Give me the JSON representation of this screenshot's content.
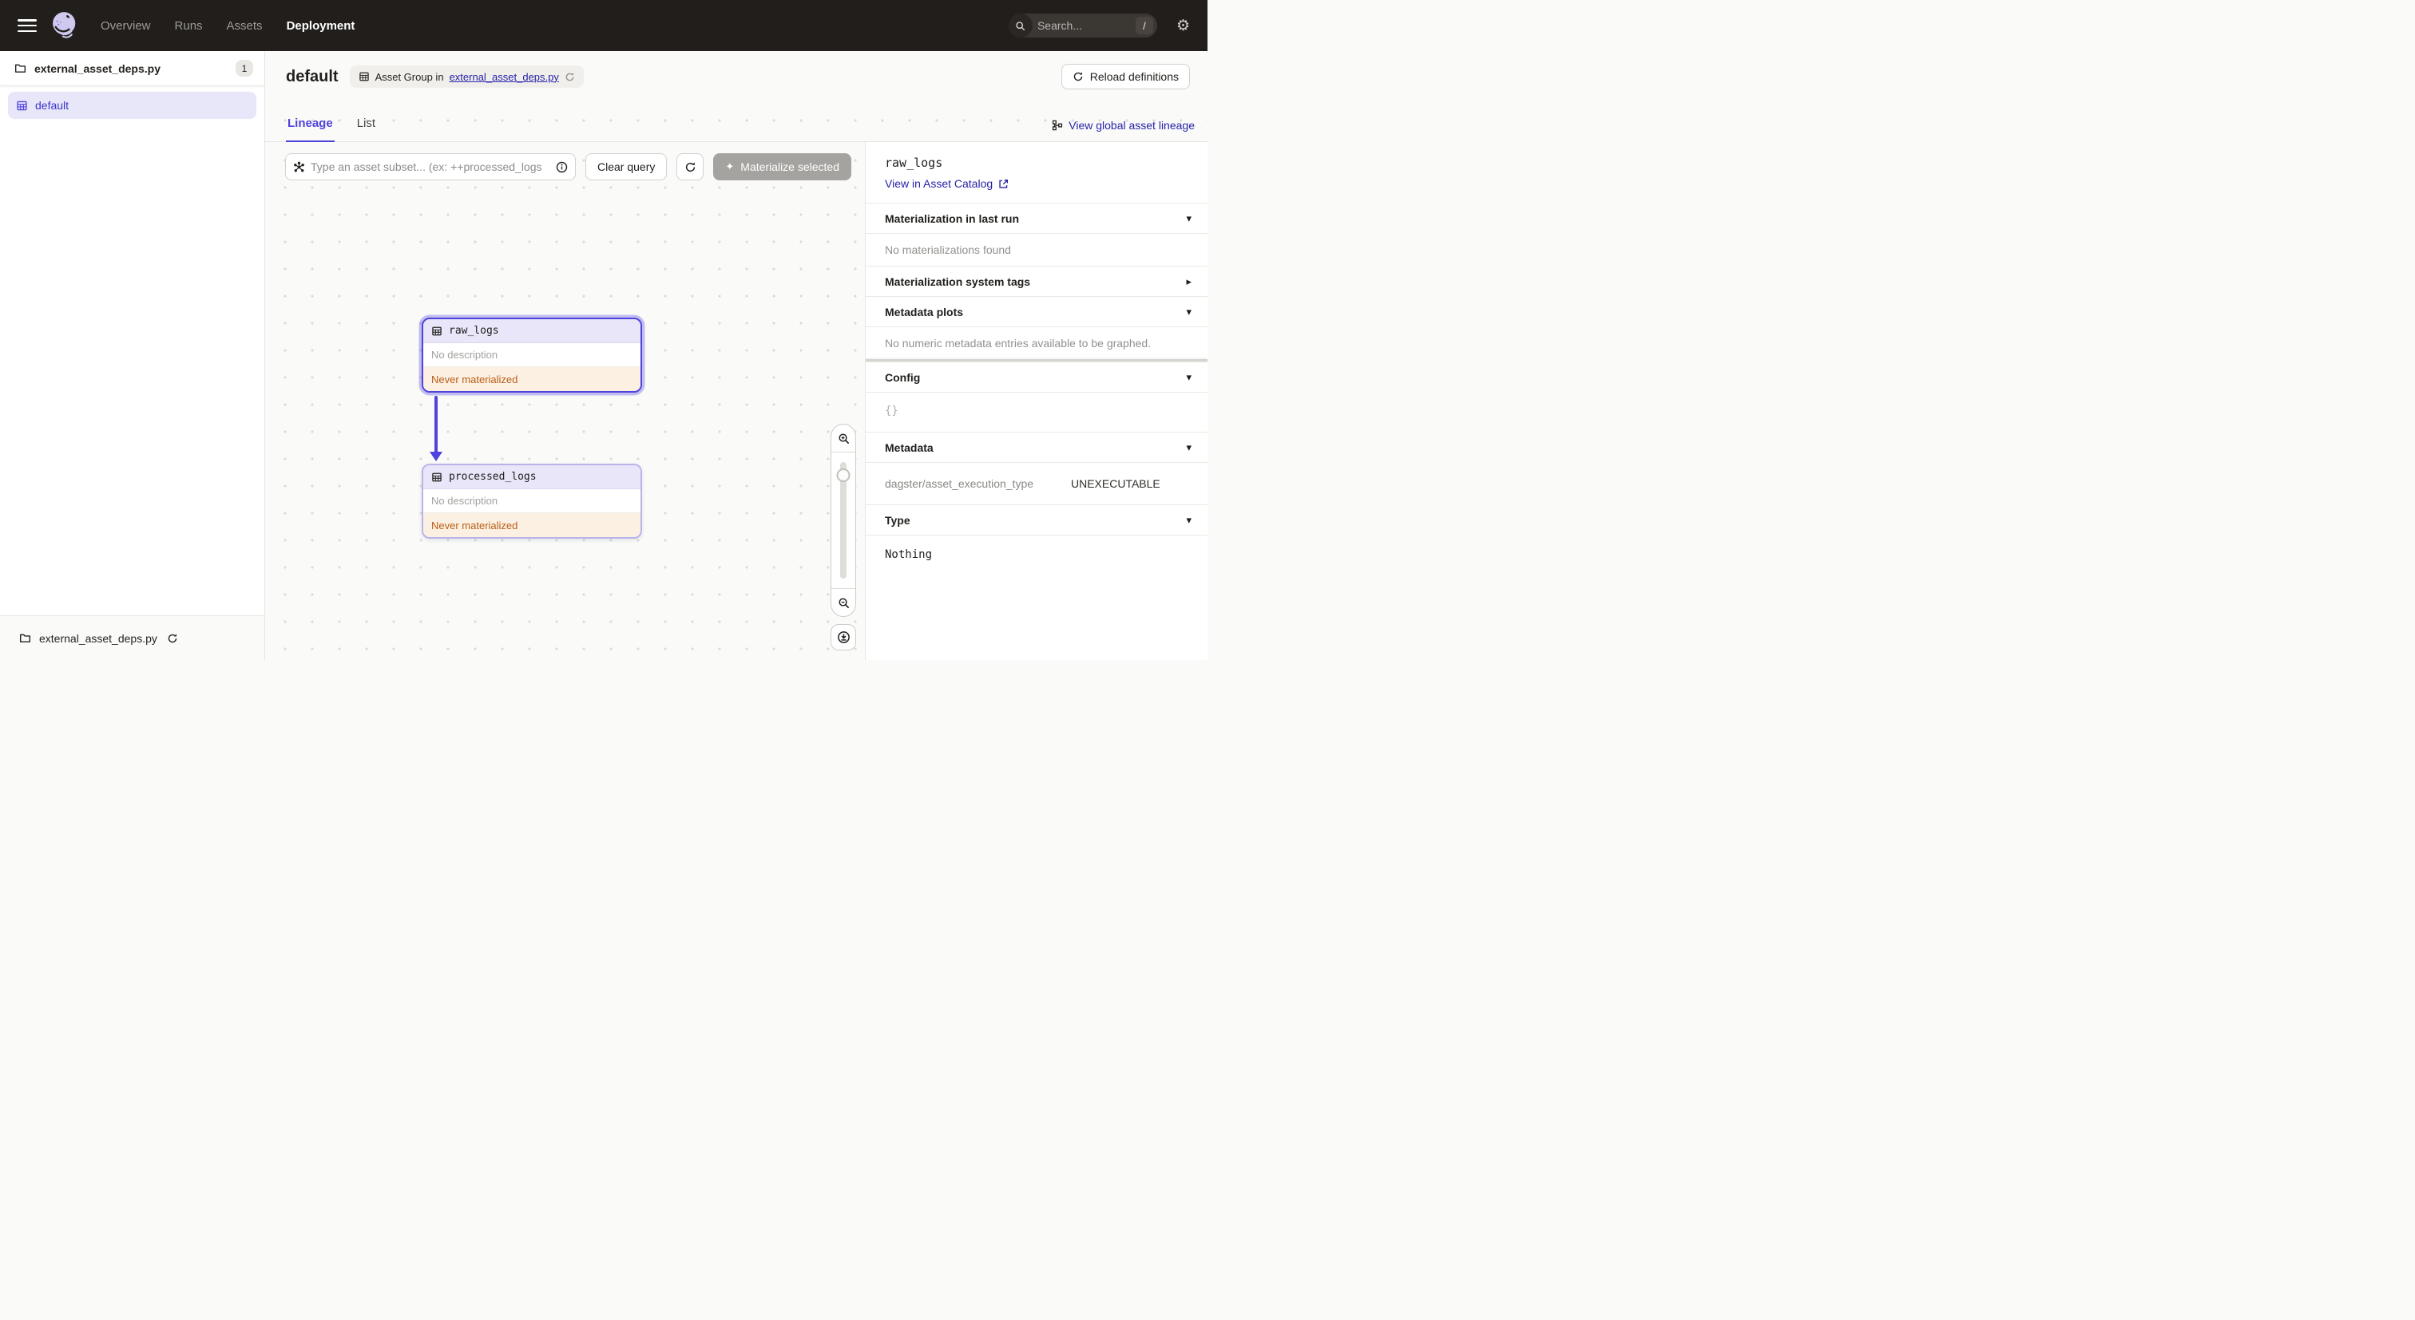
{
  "colors": {
    "accent": "#4F43DD",
    "link": "#2823A8",
    "warn_text": "#BA5D17",
    "warn_bg": "#FBF0E2",
    "nav_bg": "#211E1C",
    "selected_group_bg": "#E8E7FA"
  },
  "topnav": {
    "menu_items": [
      {
        "label": "Overview"
      },
      {
        "label": "Runs"
      },
      {
        "label": "Assets"
      },
      {
        "label": "Deployment"
      }
    ],
    "search_placeholder": "Search...",
    "search_shortcut": "/"
  },
  "sidebar": {
    "module": {
      "label": "external_asset_deps.py",
      "badge": "1"
    },
    "group": {
      "label": "default"
    },
    "footer": {
      "label": "external_asset_deps.py"
    }
  },
  "header": {
    "title": "default",
    "asset_group_prefix": "Asset Group in",
    "asset_group_link": "external_asset_deps.py",
    "reload_button": "Reload definitions"
  },
  "tabs": {
    "lineage": "Lineage",
    "list": "List",
    "global_lineage_link": "View global asset lineage"
  },
  "toolbar": {
    "query_placeholder": "Type an asset subset... (ex: ++processed_logs",
    "clear_button": "Clear query",
    "materialize_button": "Materialize selected"
  },
  "graph": {
    "nodes": [
      {
        "name": "raw_logs",
        "description": "No description",
        "status": "Never materialized"
      },
      {
        "name": "processed_logs",
        "description": "No description",
        "status": "Never materialized"
      }
    ]
  },
  "panel": {
    "title": "raw_logs",
    "catalog_link": "View in Asset Catalog",
    "sections": {
      "mat_last_run": {
        "title": "Materialization in last run",
        "empty": "No materializations found"
      },
      "system_tags": {
        "title": "Materialization system tags"
      },
      "metadata_plots": {
        "title": "Metadata plots",
        "empty": "No numeric metadata entries available to be graphed."
      },
      "config": {
        "title": "Config",
        "value": "{}"
      },
      "metadata": {
        "title": "Metadata",
        "entries": [
          {
            "key": "dagster/asset_execution_type",
            "value": "UNEXECUTABLE"
          }
        ]
      },
      "type": {
        "title": "Type",
        "value": "Nothing"
      }
    }
  },
  "icons": {
    "caret_down": "▾",
    "caret_right": "▸",
    "sparkle": "✦",
    "gear": "⚙"
  }
}
